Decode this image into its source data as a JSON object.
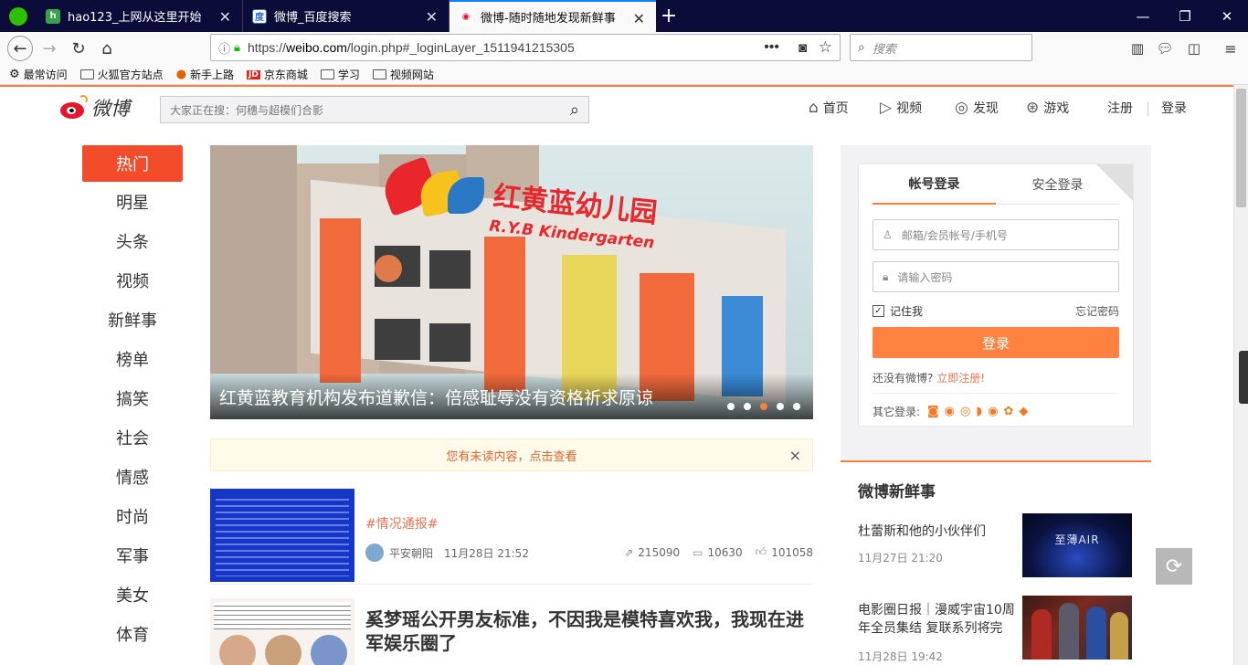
{
  "browser": {
    "tabs": [
      {
        "title": "hao123_上网从这里开始",
        "icon": "hao123-icon"
      },
      {
        "title": "微博_百度搜索",
        "icon": "baidu-icon"
      },
      {
        "title": "微博-随时随地发现新鲜事",
        "icon": "weibo-icon",
        "active": true
      }
    ],
    "new_tab": "+",
    "url_prefix": "https://",
    "url_host": "weibo.com",
    "url_path": "/login.php#_loginLayer_1511941215305",
    "search_placeholder": "搜索",
    "bookmarks": [
      "最常访问",
      "火狐官方站点",
      "新手上路",
      "京东商城",
      "学习",
      "视频网站"
    ]
  },
  "header": {
    "logo_text": "微博",
    "search_placeholder": "大家正在搜：何穗与超模们合影",
    "nav": [
      "首页",
      "视频",
      "发现",
      "游戏"
    ],
    "register": "注册",
    "login": "登录"
  },
  "left_nav": [
    "热门",
    "明星",
    "头条",
    "视频",
    "新鲜事",
    "榜单",
    "搞笑",
    "社会",
    "情感",
    "时尚",
    "军事",
    "美女",
    "体育"
  ],
  "carousel": {
    "caption": "红黄蓝教育机构发布道歉信：倍感耻辱没有资格祈求原谅",
    "sign_cn": "红黄蓝幼儿园",
    "sign_en": "R.Y.B Kindergarten",
    "slides": 5,
    "current": 3
  },
  "notice": {
    "text": "您有未读内容，点击查看",
    "close": "×"
  },
  "feed": [
    {
      "topic": "#情况通报#",
      "author": "平安朝阳",
      "time": "11月28日 21:52",
      "reposts": "215090",
      "comments": "10630",
      "likes": "101058"
    },
    {
      "title": "奚梦瑶公开男友标准，不因我是模特喜欢我，我现在进军娱乐圈了"
    }
  ],
  "login": {
    "tab_account": "帐号登录",
    "tab_secure": "安全登录",
    "username_placeholder": "邮箱/会员帐号/手机号",
    "password_placeholder": "请输入密码",
    "remember": "记住我",
    "forgot": "忘记密码",
    "submit": "登录",
    "no_account": "还没有微博?",
    "register_now": "立即注册!",
    "other_login": "其它登录:"
  },
  "fresh": {
    "title": "微博新鲜事",
    "items": [
      {
        "title": "杜蕾斯和他的小伙伴们",
        "date": "11月27日 21:20",
        "img_text": "至薄AIR"
      },
      {
        "title": "电影圈日报｜漫威宇宙10周年全员集结 复联系列将完",
        "date": "11月28日 19:42"
      }
    ]
  },
  "colors": {
    "accent": "#fa7d3c",
    "active_nav": "#f34c2b",
    "login_btn": "#ff8140",
    "tab_bar": "#0c0c3a"
  }
}
